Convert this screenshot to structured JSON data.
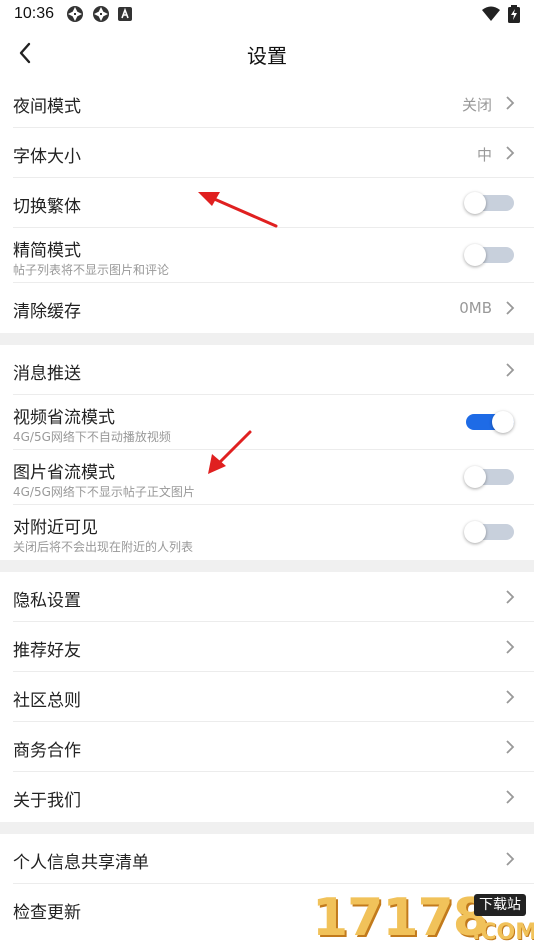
{
  "status": {
    "time": "10:36"
  },
  "nav": {
    "title": "设置"
  },
  "groups": [
    [
      {
        "label": "夜间模式",
        "value": "关闭",
        "type": "link"
      },
      {
        "label": "字体大小",
        "value": "中",
        "type": "link"
      },
      {
        "label": "切换繁体",
        "type": "toggle",
        "on": false
      },
      {
        "label": "精简模式",
        "sub": "帖子列表将不显示图片和评论",
        "type": "toggle",
        "on": false
      },
      {
        "label": "清除缓存",
        "value": "0MB",
        "type": "link"
      }
    ],
    [
      {
        "label": "消息推送",
        "type": "link"
      },
      {
        "label": "视频省流模式",
        "sub": "4G/5G网络下不自动播放视频",
        "type": "toggle",
        "on": true
      },
      {
        "label": "图片省流模式",
        "sub": "4G/5G网络下不显示帖子正文图片",
        "type": "toggle",
        "on": false
      },
      {
        "label": "对附近可见",
        "sub": "关闭后将不会出现在附近的人列表",
        "type": "toggle",
        "on": false
      }
    ],
    [
      {
        "label": "隐私设置",
        "type": "link"
      },
      {
        "label": "推荐好友",
        "type": "link"
      },
      {
        "label": "社区总则",
        "type": "link"
      },
      {
        "label": "商务合作",
        "type": "link"
      },
      {
        "label": "关于我们",
        "type": "link"
      }
    ],
    [
      {
        "label": "个人信息共享清单",
        "type": "link"
      },
      {
        "label": "检查更新",
        "type": "link"
      }
    ]
  ],
  "watermark": {
    "number": "17178",
    "tag": "下载站",
    "domain": ".COM"
  },
  "colors": {
    "accent": "#1e6be6",
    "annotation": "#e02020"
  }
}
